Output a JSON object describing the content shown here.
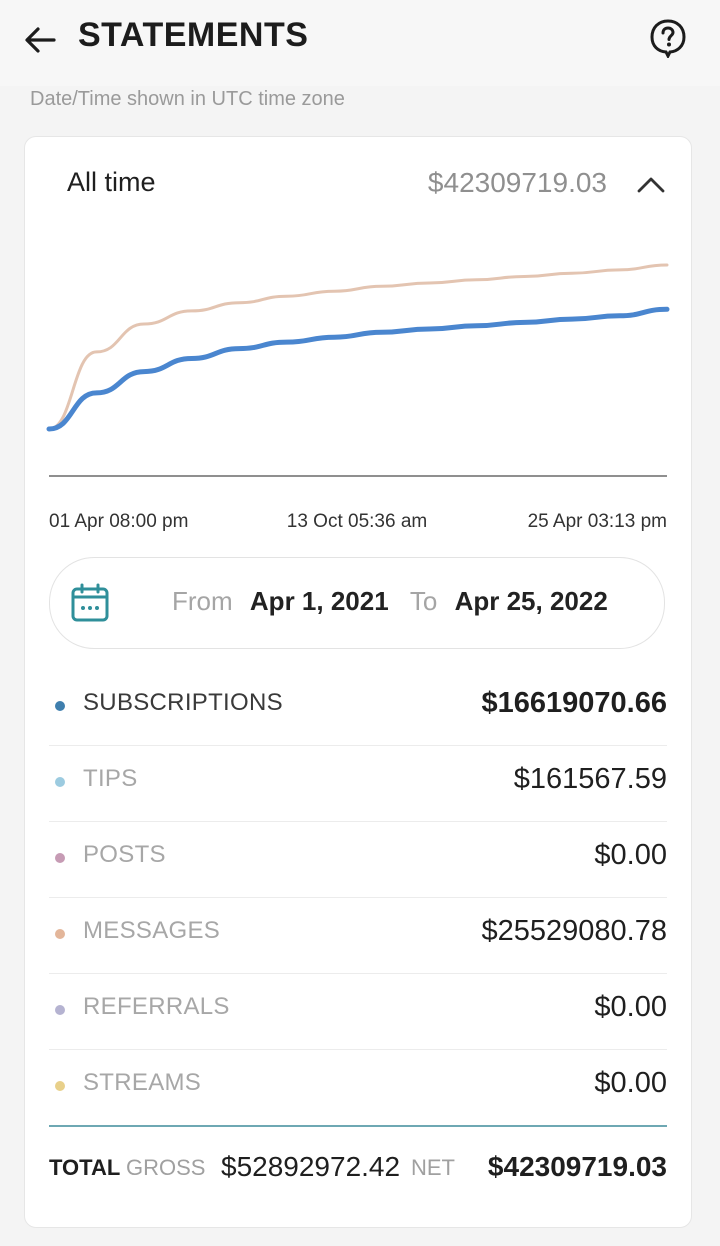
{
  "header": {
    "title": "STATEMENTS",
    "back_icon": "arrow-left-icon",
    "help_icon": "question-circle-icon"
  },
  "timezone_note": "Date/Time shown in UTC time zone",
  "summary": {
    "period_label": "All time",
    "period_total": "$42309719.03",
    "collapse_icon": "chevron-up-icon"
  },
  "chart_data": {
    "type": "line",
    "x": [
      "01 Apr 08:00 pm",
      "13 Oct 05:36 am",
      "25 Apr 03:13 pm"
    ],
    "xtick_labels": [
      "01 Apr 08:00 pm",
      "13 Oct 05:36 am",
      "25 Apr 03:13 pm"
    ],
    "series": [
      {
        "color": "#e3c4b1",
        "values": [
          0,
          0.47,
          0.64,
          0.72,
          0.77,
          0.81,
          0.84,
          0.87,
          0.89,
          0.91,
          0.93,
          0.95,
          0.97,
          1.0
        ]
      },
      {
        "color": "#4a86cf",
        "values": [
          0,
          0.22,
          0.35,
          0.43,
          0.49,
          0.53,
          0.56,
          0.59,
          0.61,
          0.63,
          0.65,
          0.67,
          0.69,
          0.73
        ]
      }
    ],
    "grid": false,
    "legend": "none"
  },
  "date_range": {
    "from_label": "From",
    "from_value": "Apr 1, 2021",
    "to_label": "To",
    "to_value": "Apr 25, 2022",
    "icon": "calendar-icon"
  },
  "categories": [
    {
      "label": "SUBSCRIPTIONS",
      "amount": "$16619070.66",
      "dot_color": "#3f7fae",
      "label_color": "#3a3a3a",
      "bold": true
    },
    {
      "label": "TIPS",
      "amount": "$161567.59",
      "dot_color": "#9ccbe0",
      "label_color": "#a7a7a7",
      "bold": false
    },
    {
      "label": "POSTS",
      "amount": "$0.00",
      "dot_color": "#c69bb4",
      "label_color": "#a7a7a7",
      "bold": false
    },
    {
      "label": "MESSAGES",
      "amount": "$25529080.78",
      "dot_color": "#e3b69a",
      "label_color": "#a7a7a7",
      "bold": false
    },
    {
      "label": "REFERRALS",
      "amount": "$0.00",
      "dot_color": "#b5b3d1",
      "label_color": "#a7a7a7",
      "bold": false
    },
    {
      "label": "STREAMS",
      "amount": "$0.00",
      "dot_color": "#e8d08a",
      "label_color": "#a7a7a7",
      "bold": false
    }
  ],
  "totals": {
    "total_label": "TOTAL",
    "gross_label": "GROSS",
    "gross_value": "$52892972.42",
    "net_label": "NET",
    "net_value": "$42309719.03",
    "divider_color": "#6ea8b3"
  }
}
